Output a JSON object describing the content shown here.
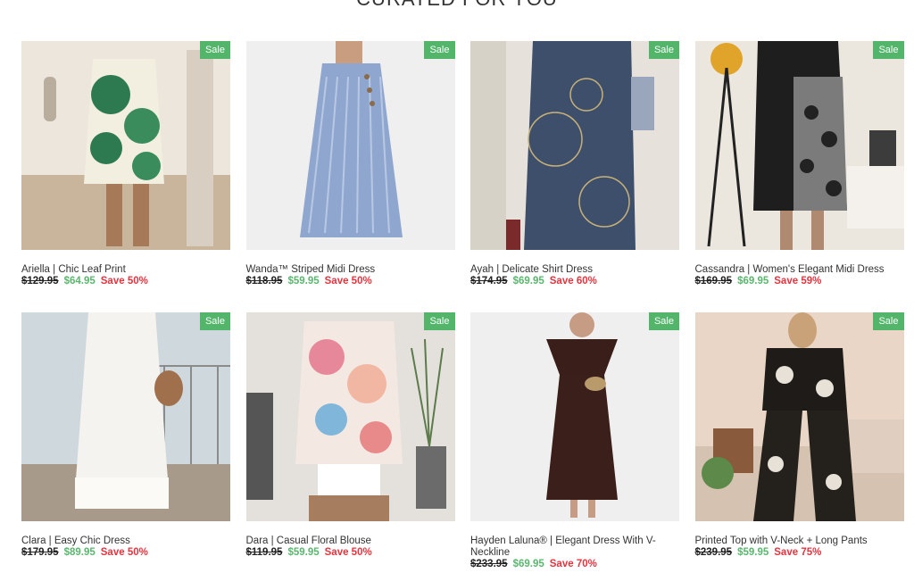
{
  "section": {
    "title": "CURATED FOR YOU"
  },
  "colors": {
    "sale_badge": "#52b56a",
    "new_price": "#5bb66e",
    "save": "#e4343f"
  },
  "products": [
    {
      "name": "Ariella | Chic Leaf Print",
      "old_price": "$129.95",
      "price": "$64.95",
      "save": "Save 50%",
      "badge": "Sale"
    },
    {
      "name": "Wanda™ Striped Midi Dress",
      "old_price": "$118.95",
      "price": "$59.95",
      "save": "Save 50%",
      "badge": "Sale"
    },
    {
      "name": "Ayah | Delicate Shirt Dress",
      "old_price": "$174.95",
      "price": "$69.95",
      "save": "Save 60%",
      "badge": "Sale"
    },
    {
      "name": "Cassandra | Women's Elegant Midi Dress",
      "old_price": "$169.95",
      "price": "$69.95",
      "save": "Save 59%",
      "badge": "Sale"
    },
    {
      "name": "Clara | Easy Chic Dress",
      "old_price": "$179.95",
      "price": "$89.95",
      "save": "Save 50%",
      "badge": "Sale"
    },
    {
      "name": "Dara | Casual Floral Blouse",
      "old_price": "$119.95",
      "price": "$59.95",
      "save": "Save 50%",
      "badge": "Sale"
    },
    {
      "name": "Hayden Laluna® | Elegant Dress With V-Neckline",
      "old_price": "$233.95",
      "price": "$69.95",
      "save": "Save 70%",
      "badge": "Sale"
    },
    {
      "name": "Printed Top with V-Neck + Long Pants",
      "old_price": "$239.95",
      "price": "$59.95",
      "save": "Save 75%",
      "badge": "Sale"
    }
  ]
}
